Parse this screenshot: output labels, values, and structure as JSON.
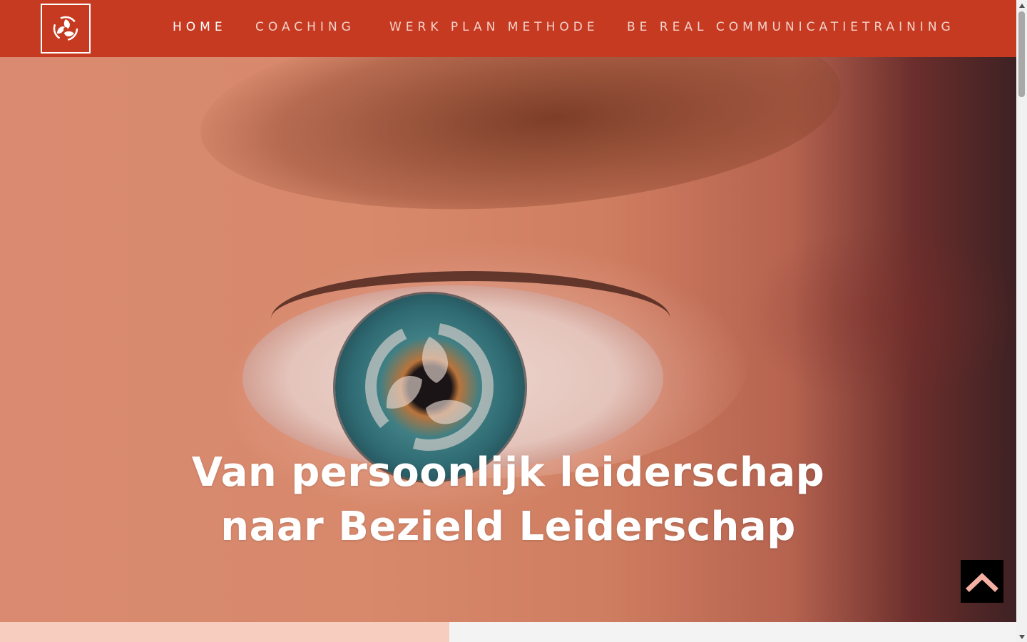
{
  "header": {
    "logo_icon": "triskelion-logo-icon",
    "bg_color": "#c63a22",
    "nav": [
      {
        "label": "HOME",
        "active": true
      },
      {
        "label": "COACHING",
        "active": false
      },
      {
        "label": "WERK PLAN METHODE",
        "active": false
      },
      {
        "label": "BE REAL COMMUNICATIETRAINING",
        "active": false
      }
    ]
  },
  "hero": {
    "title_line1": "Van persoonlijk leiderschap",
    "title_line2": "naar Bezield Leiderschap",
    "background": "close-up-eye-photo"
  },
  "scroll_to_top": {
    "icon": "chevron-up-icon",
    "icon_color": "#f6b0a3"
  },
  "colors": {
    "accent": "#c63a22",
    "strip": "#f6cdbf"
  }
}
